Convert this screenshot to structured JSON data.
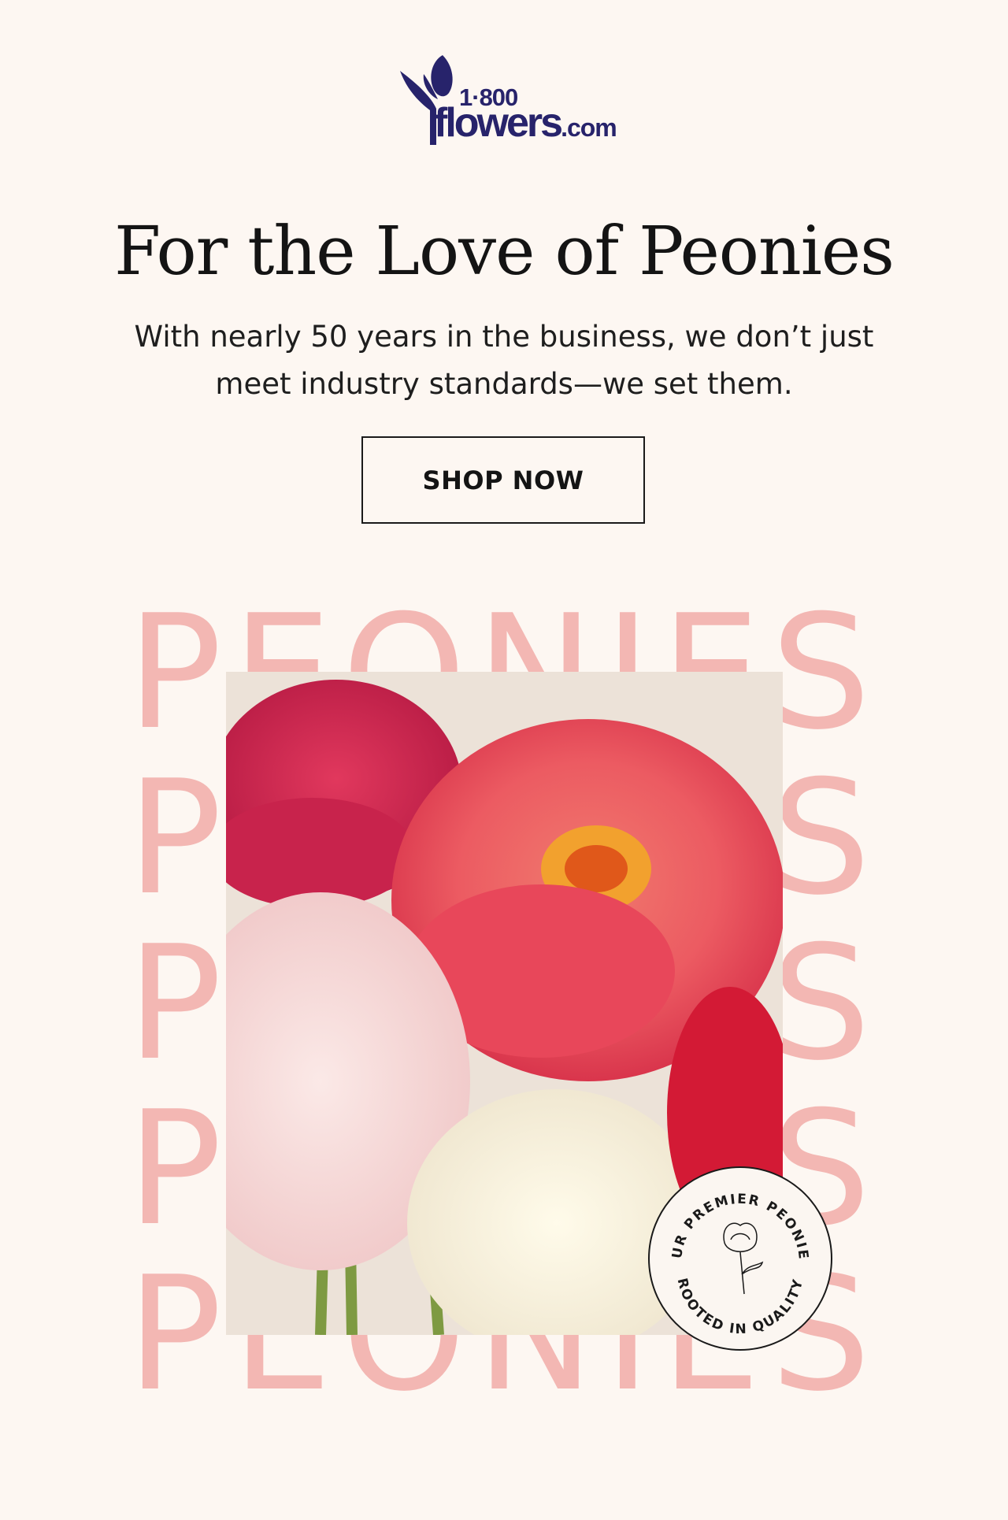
{
  "logo": {
    "name": "1-800-flowers-logo",
    "top_text": "1·800",
    "main_text": "flowers",
    "suffix": ".com",
    "color": "#27236b"
  },
  "hero": {
    "headline": "For the Love of Peonies",
    "subtext": "With nearly 50 years in the business, we don’t just meet industry standards—we set them.",
    "cta_label": "SHOP NOW"
  },
  "typography_bg": {
    "word": "PEONIES",
    "color": "#f3b7b3",
    "row_count": 5
  },
  "photo": {
    "subject": "peonies-bouquet-photo"
  },
  "seal": {
    "top_text": "OUR PREMIER PEONIES",
    "bottom_text": "ROOTED IN QUALITY"
  },
  "colors": {
    "background": "#fdf7f2",
    "text": "#141414"
  }
}
